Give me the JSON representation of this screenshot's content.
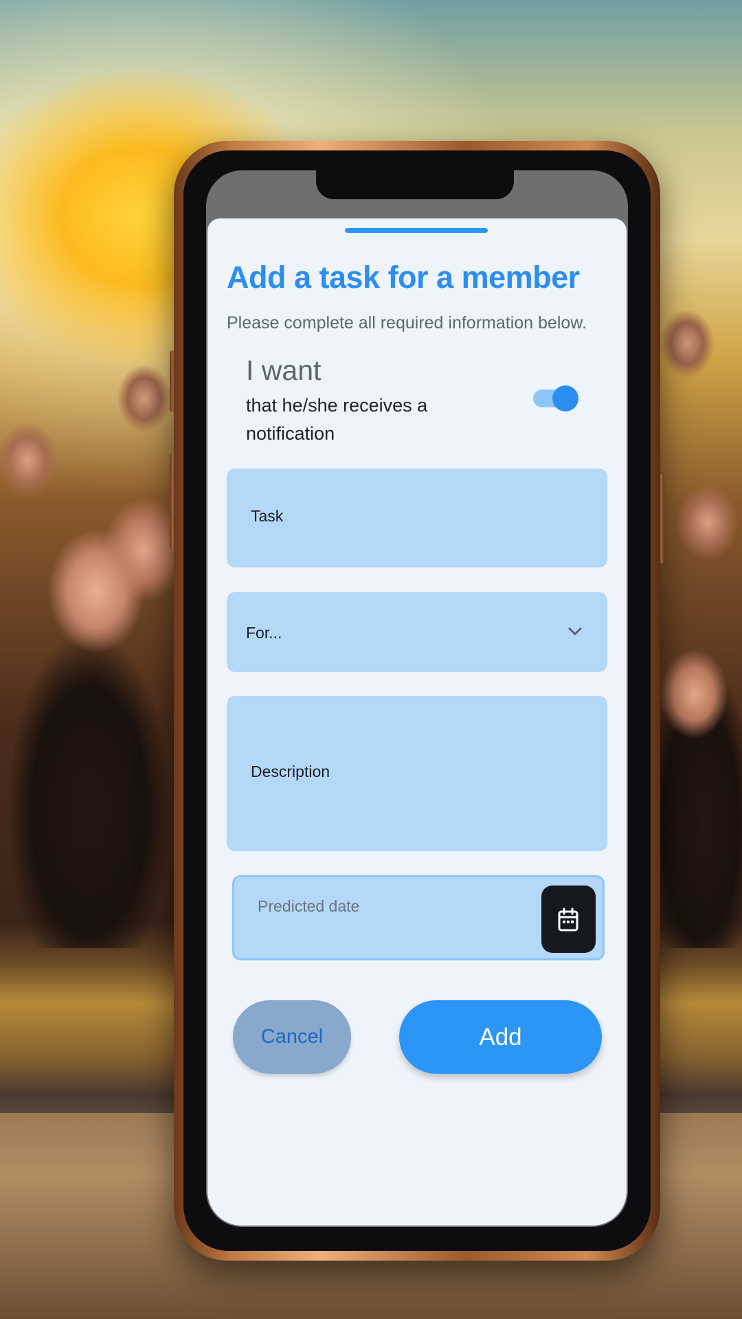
{
  "form": {
    "title": "Add a task for a member",
    "subtitle": "Please complete all required information below.",
    "notify_heading": "I want",
    "notify_text": "that he/she receives a notification",
    "notify_enabled": true
  },
  "fields": {
    "task_label": "Task",
    "for_label": "For...",
    "description_label": "Description",
    "date_label": "Predicted date"
  },
  "buttons": {
    "cancel_label": "Cancel",
    "add_label": "Add"
  },
  "icons": {
    "dropdown": "chevron-down-icon",
    "calendar": "calendar-icon"
  },
  "colors": {
    "accent": "#2b8ef0",
    "field_bg": "#b3d8f8",
    "sheet_bg": "#eff4fa",
    "cancel_bg": "#88a9cc",
    "calendar_button_bg": "#15191e"
  }
}
